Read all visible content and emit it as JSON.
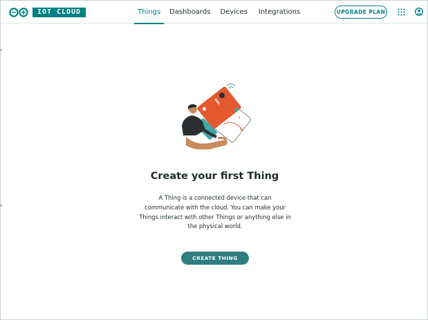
{
  "header": {
    "logo_text": "IOT CLOUD",
    "nav": [
      {
        "label": "Things",
        "active": true
      },
      {
        "label": "Dashboards",
        "active": false
      },
      {
        "label": "Devices",
        "active": false
      },
      {
        "label": "Integrations",
        "active": false
      }
    ],
    "upgrade_label": "UPGRADE PLAN",
    "icons": {
      "apps": "apps-grid-icon",
      "user": "user-account-icon",
      "logo": "arduino-infinity-icon"
    }
  },
  "empty_state": {
    "title": "Create your first Thing",
    "description": "A Thing is a connected device that can communicate with the cloud. You can make your Things interact with other Things or anything else in the physical world.",
    "cta_label": "CREATE THING"
  },
  "colors": {
    "accent": "#008184",
    "button": "#2f7d80",
    "illustration_orange": "#e4592e",
    "illustration_teal": "#3fa8a8"
  }
}
